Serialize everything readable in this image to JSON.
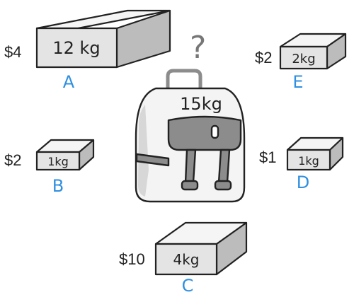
{
  "question_mark": "?",
  "bag": {
    "capacity": "15kg"
  },
  "items": [
    {
      "id": "A",
      "price": "$4",
      "weight": "12 kg"
    },
    {
      "id": "E",
      "price": "$2",
      "weight": "2kg"
    },
    {
      "id": "B",
      "price": "$2",
      "weight": "1kg"
    },
    {
      "id": "D",
      "price": "$1",
      "weight": "1kg"
    },
    {
      "id": "C",
      "price": "$10",
      "weight": "4kg"
    }
  ],
  "colors": {
    "letter": "#2f8fe0",
    "question_mark": "#777777"
  }
}
